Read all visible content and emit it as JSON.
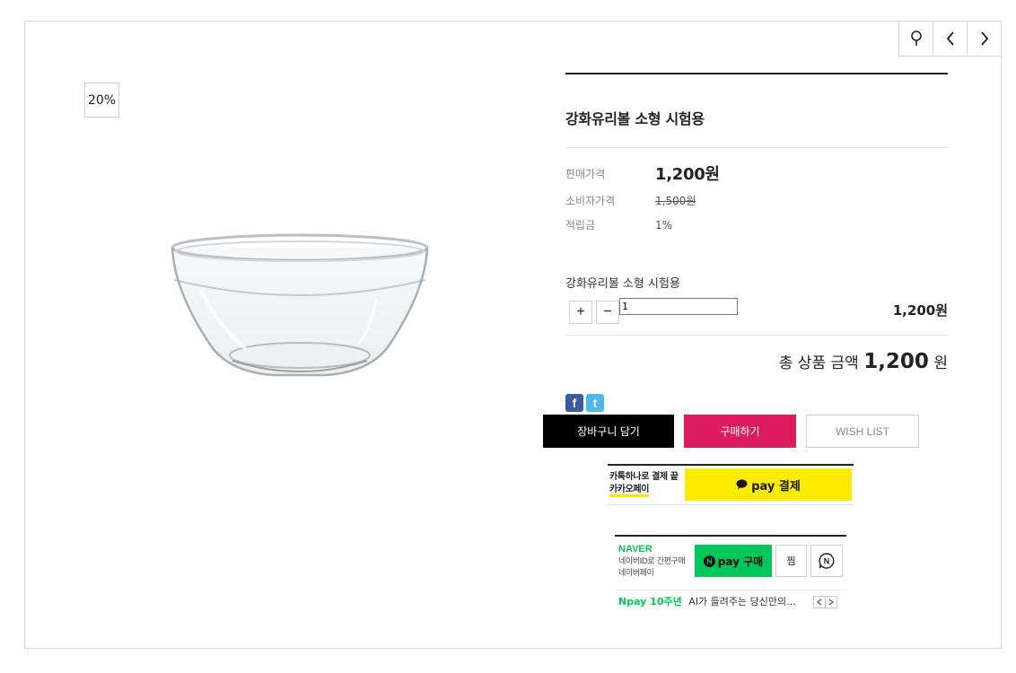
{
  "nav": {
    "icons": [
      "search-icon",
      "chevron-left-icon",
      "chevron-right-icon"
    ]
  },
  "product": {
    "discount_badge": "20%",
    "title": "강화유리볼 소형 시험용",
    "sale_price_label": "판매가격",
    "sale_price": "1,200원",
    "consumer_price_label": "소비자가격",
    "consumer_price": "1,500원",
    "points_label": "적립금",
    "points": "1%"
  },
  "option": {
    "name": "강화유리볼 소형 시험용",
    "plus_label": "+",
    "minus_label": "−",
    "quantity": "1",
    "line_price": "1,200원"
  },
  "total": {
    "label": "총 상품 금액",
    "amount": "1,200",
    "unit": "원"
  },
  "share": {
    "facebook_glyph": "f",
    "twitter_glyph": "t"
  },
  "actions": {
    "cart_label": "장바구니 담기",
    "buy_label": "구매하기",
    "wish_label": "WISH LIST"
  },
  "kakao": {
    "text_line1": "카톡하나로 결제 끝",
    "text_line2": "카카오페이",
    "button_label": "pay 결제"
  },
  "naver": {
    "logo": "NAVER",
    "sub_line1": "네이버ID로 간편구매",
    "sub_line2": "네이버페이",
    "pay_label": "pay 구매",
    "zzim_label": "찜",
    "talk_glyph": "N",
    "news_tag": "Npay 10주년",
    "news_text": "AI가 들려주는 당신만의…"
  },
  "colors": {
    "buy_button": "#dc1c5e",
    "kakao_yellow": "#ffeb00",
    "naver_green": "#03c75a"
  }
}
